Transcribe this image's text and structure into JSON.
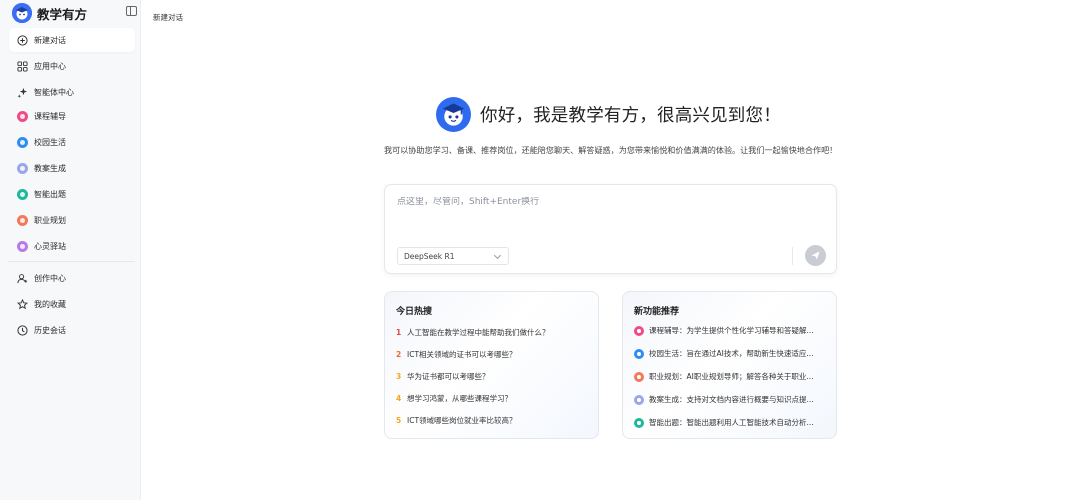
{
  "brand": {
    "name": "教学有方"
  },
  "sidebar": {
    "items": [
      {
        "label": "新建对话"
      },
      {
        "label": "应用中心"
      },
      {
        "label": "智能体中心"
      },
      {
        "label": "课程辅导",
        "color": "#ee4c82"
      },
      {
        "label": "校园生活",
        "color": "#2f8cf0"
      },
      {
        "label": "教案生成",
        "color": "#9aa6e8"
      },
      {
        "label": "智能出题",
        "color": "#1fb89a"
      },
      {
        "label": "职业规划",
        "color": "#f07a5a"
      },
      {
        "label": "心灵驿站",
        "color": "#b67be6"
      }
    ],
    "bottom": [
      {
        "label": "创作中心"
      },
      {
        "label": "我的收藏"
      },
      {
        "label": "历史会话"
      }
    ]
  },
  "header": {
    "tab_label": "新建对话"
  },
  "hero": {
    "title": "你好，我是教学有方，很高兴见到您！",
    "intro": "我可以协助您学习、备课、推荐岗位，还能陪您聊天、解答疑惑，为您带来愉悦和价值满满的体验。让我们一起愉快地合作吧！"
  },
  "composer": {
    "placeholder": "点这里，尽管问，Shift+Enter换行",
    "model": "DeepSeek R1"
  },
  "hot": {
    "title": "今日热搜",
    "items": [
      {
        "rank": "1",
        "text": "人工智能在教学过程中能帮助我们做什么？",
        "color": "#e8453c"
      },
      {
        "rank": "2",
        "text": "ICT相关领域的证书可以考哪些？",
        "color": "#f06a35"
      },
      {
        "rank": "3",
        "text": "华为证书都可以考哪些？",
        "color": "#f5a623"
      },
      {
        "rank": "4",
        "text": "想学习鸿蒙，从哪些课程学习？",
        "color": "#f5a623"
      },
      {
        "rank": "5",
        "text": "ICT领域哪些岗位就业率比较高？",
        "color": "#f5a623"
      }
    ]
  },
  "features": {
    "title": "新功能推荐",
    "items": [
      {
        "text": "课程辅导：为学生提供个性化学习辅导和答疑解...",
        "color": "#ee4c82"
      },
      {
        "text": "校园生活：旨在通过AI技术，帮助新生快速适应...",
        "color": "#2f8cf0"
      },
      {
        "text": "职业规划：AI职业规划导师；解答各种关于职业...",
        "color": "#f07a5a"
      },
      {
        "text": "教案生成：支持对文档内容进行概要与知识点提...",
        "color": "#9aa6e8"
      },
      {
        "text": "智能出题：智能出题利用人工智能技术自动分析...",
        "color": "#1fb89a"
      }
    ]
  }
}
